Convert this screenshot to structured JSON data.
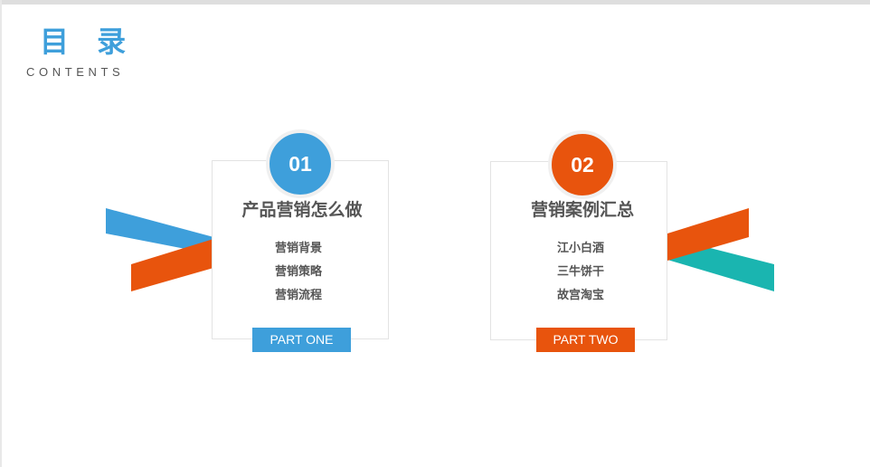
{
  "page": {
    "title": "目 录",
    "subtitle": "CONTENTS"
  },
  "colors": {
    "blue": "#3e9fdb",
    "orange": "#e8540d",
    "teal": "#1ab5b0",
    "text": "#555555"
  },
  "sections": [
    {
      "number": "01",
      "heading": "产品营销怎么做",
      "items": [
        "营销背景",
        "营销策略",
        "营销流程"
      ],
      "part_label": "PART ONE"
    },
    {
      "number": "02",
      "heading": "营销案例汇总",
      "items": [
        "江小白酒",
        "三牛饼干",
        "故宫淘宝"
      ],
      "part_label": "PART TWO"
    }
  ]
}
